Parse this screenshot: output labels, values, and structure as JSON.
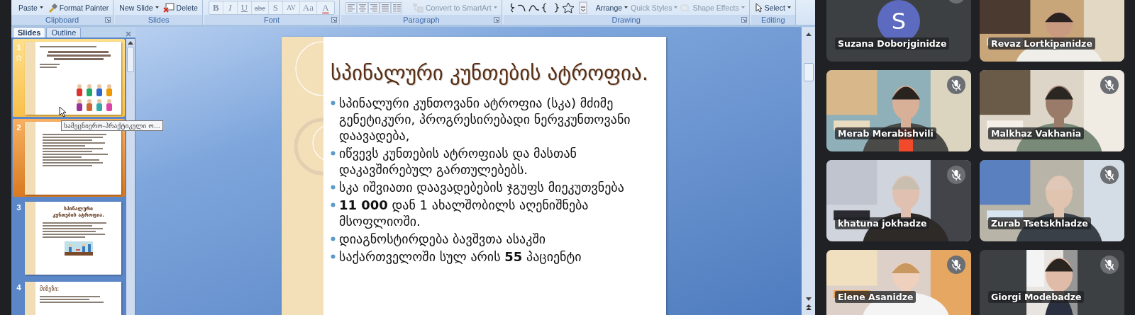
{
  "ribbon": {
    "groups": [
      {
        "label": "Clipboard",
        "launcher": true,
        "controls": [
          {
            "kind": "paste",
            "label": "Paste",
            "disabled": false
          },
          {
            "kind": "format-painter",
            "label": "Format Painter",
            "disabled": false
          }
        ]
      },
      {
        "label": "Slides",
        "launcher": false,
        "controls": [
          {
            "kind": "new-slide",
            "label": "New Slide",
            "disabled": false
          },
          {
            "kind": "delete",
            "label": "Delete",
            "disabled": false
          }
        ]
      },
      {
        "label": "Font",
        "launcher": true,
        "controls": [
          {
            "kind": "bold",
            "label": "B",
            "disabled": true
          },
          {
            "kind": "italic",
            "label": "I",
            "disabled": true
          },
          {
            "kind": "underline",
            "label": "U",
            "disabled": true
          },
          {
            "kind": "strike",
            "label": "abe",
            "disabled": true
          },
          {
            "kind": "shadow",
            "label": "S",
            "disabled": true
          },
          {
            "kind": "spacing",
            "label": "AV",
            "disabled": true
          },
          {
            "kind": "case",
            "label": "Aa",
            "disabled": true
          },
          {
            "kind": "color",
            "label": "A",
            "disabled": true
          }
        ]
      },
      {
        "label": "Paragraph",
        "launcher": true,
        "controls": [
          {
            "kind": "align-left",
            "disabled": true
          },
          {
            "kind": "align-center",
            "disabled": true
          },
          {
            "kind": "align-right",
            "disabled": true
          },
          {
            "kind": "justify",
            "disabled": true
          },
          {
            "kind": "columns",
            "disabled": true
          },
          {
            "kind": "smartart",
            "label": "Convert to SmartArt",
            "disabled": true
          }
        ]
      },
      {
        "label": "Drawing",
        "launcher": true,
        "controls": [
          {
            "kind": "shapes",
            "disabled": false
          },
          {
            "kind": "arrange",
            "label": "Arrange",
            "disabled": false
          },
          {
            "kind": "quick-styles",
            "label": "Quick Styles",
            "disabled": true
          },
          {
            "kind": "shape-effects",
            "label": "Shape Effects",
            "disabled": true
          }
        ]
      },
      {
        "label": "Editing",
        "launcher": false,
        "controls": [
          {
            "kind": "select",
            "label": "Select",
            "disabled": false
          }
        ]
      }
    ]
  },
  "slides_pane": {
    "tabs": [
      {
        "label": "Slides",
        "selected": true
      },
      {
        "label": "Outline",
        "selected": false
      }
    ],
    "thumbnails": [
      {
        "number": "1",
        "selected": false,
        "hovered": true,
        "animation": true,
        "kind": "title-pictures"
      },
      {
        "number": "2",
        "selected": true,
        "hovered": false,
        "animation": false,
        "kind": "bullets"
      },
      {
        "number": "3",
        "selected": false,
        "hovered": false,
        "animation": false,
        "kind": "title-bullets-picture",
        "title": "სპინალური კუნთების ატროფია."
      },
      {
        "number": "4",
        "selected": false,
        "hovered": false,
        "animation": false,
        "kind": "title-text",
        "title": "მიზეზი:"
      }
    ],
    "tooltip": "სამეცნიერო-პრაქტიკული ო..."
  },
  "slide": {
    "title": "სპინალური კუნთების ატროფია.",
    "bullets": [
      "სპინალური კუნთოვანი ატროფია (სკა) მძიმე გენეტიკური, პროგრესირებადი ნერვკუნთოვანი დაავადება,",
      "იწვევს კუნთების ატროფიას და მასთან დაკავშირებულ გართულებებს.",
      "სკა იშვიათი დაავადებების ჯგუფს მიეკუთვნება",
      "**11 000** დან 1 ახალშობილს აღენიშნება მსოფლიოში.",
      "დიაგნოსტირდება ბავშვთა ასაკში",
      "საქართველოში სულ არის **55** პაციენტი"
    ]
  },
  "participants": [
    {
      "name": "Suzana Doborjginidze",
      "muted": true,
      "kind": "avatar",
      "initial": "S"
    },
    {
      "name": "Revaz Lortkipanidze",
      "muted": false,
      "kind": "picture"
    },
    {
      "name": "Merab Merabishvili",
      "muted": true,
      "kind": "picture"
    },
    {
      "name": "Malkhaz Vakhania",
      "muted": true,
      "kind": "picture"
    },
    {
      "name": "khatuna jokhadze",
      "muted": true,
      "kind": "picture"
    },
    {
      "name": "Zurab Tsetskhladze",
      "muted": true,
      "kind": "picture"
    },
    {
      "name": "Elene Asanidze",
      "muted": true,
      "kind": "picture"
    },
    {
      "name": "Giorgi Modebadze",
      "muted": true,
      "kind": "picture-strip"
    }
  ]
}
